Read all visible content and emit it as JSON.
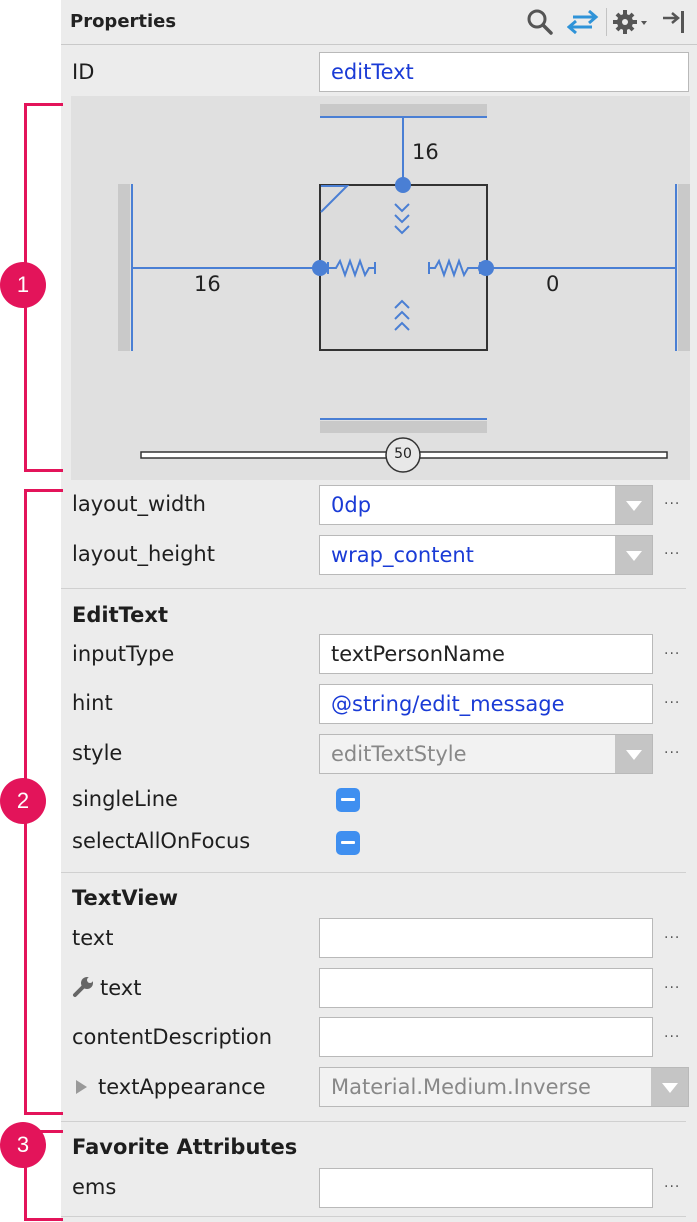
{
  "header": {
    "title": "Properties",
    "icons": [
      "search-icon",
      "swap-icon",
      "gear-icon",
      "pin-icon"
    ]
  },
  "id_row": {
    "label": "ID",
    "value": "editText"
  },
  "constraint": {
    "top_margin": "16",
    "left_margin": "16",
    "right_margin": "0",
    "bias": "50"
  },
  "layout": {
    "width": {
      "label": "layout_width",
      "value": "0dp"
    },
    "height": {
      "label": "layout_height",
      "value": "wrap_content"
    }
  },
  "edittext": {
    "section": "EditText",
    "inputType": {
      "label": "inputType",
      "value": "textPersonName"
    },
    "hint": {
      "label": "hint",
      "value": "@string/edit_message"
    },
    "style": {
      "label": "style",
      "value": "editTextStyle"
    },
    "singleLine": {
      "label": "singleLine"
    },
    "selectAllOnFocus": {
      "label": "selectAllOnFocus"
    }
  },
  "textview": {
    "section": "TextView",
    "text": {
      "label": "text",
      "value": ""
    },
    "text_tools": {
      "label": "text",
      "value": ""
    },
    "contentDescription": {
      "label": "contentDescription",
      "value": ""
    },
    "textAppearance": {
      "label": "textAppearance",
      "value": "Material.Medium.Inverse"
    }
  },
  "favorites": {
    "section": "Favorite Attributes",
    "ems": {
      "label": "ems",
      "value": ""
    }
  },
  "callouts": [
    "1",
    "2",
    "3"
  ],
  "more_label": "...",
  "colors": {
    "accent": "#e3145a",
    "link": "#1a3bd6",
    "blueprint": "#4a7fd4",
    "checkbox": "#3f8ff0"
  }
}
